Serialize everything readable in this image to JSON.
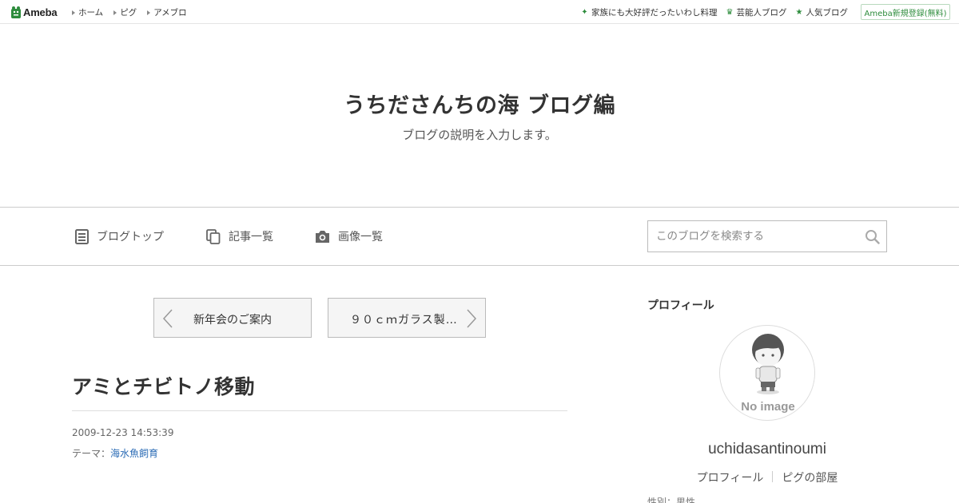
{
  "topbar": {
    "logo_text": "Ameba",
    "nav_left": [
      {
        "label": "ホーム"
      },
      {
        "label": "ピグ"
      },
      {
        "label": "アメブロ"
      }
    ],
    "nav_right": [
      {
        "icon": "sparkle-icon",
        "label": "家族にも大好評だったいわし料理"
      },
      {
        "icon": "crown-icon",
        "label": "芸能人ブログ"
      },
      {
        "icon": "star-icon",
        "label": "人気ブログ"
      }
    ],
    "signup_label": "Ameba新規登録(無料)",
    "accent_color": "#2d8c3c"
  },
  "header": {
    "title": "うちださんちの海 ブログ編",
    "description": "ブログの説明を入力します。"
  },
  "menu": {
    "items": [
      {
        "icon": "document-icon",
        "label": "ブログトップ"
      },
      {
        "icon": "copy-icon",
        "label": "記事一覧"
      },
      {
        "icon": "camera-icon",
        "label": "画像一覧"
      }
    ],
    "search_placeholder": "このブログを検索する"
  },
  "pager": {
    "prev_label": "新年会のご案内",
    "next_label": "９０ｃｍガラス製オ…"
  },
  "article": {
    "title": "アミとチビトノ移動",
    "date": "2009-12-23 14:53:39",
    "theme_prefix": "テーマ：",
    "theme_link": "海水魚飼育",
    "link_color": "#2a6bb5"
  },
  "sidebar": {
    "heading": "プロフィール",
    "avatar_text": "No image",
    "username": "uchidasantinoumi",
    "links": [
      "プロフィール",
      "ピグの部屋"
    ],
    "cut_text": "性別：男性"
  }
}
